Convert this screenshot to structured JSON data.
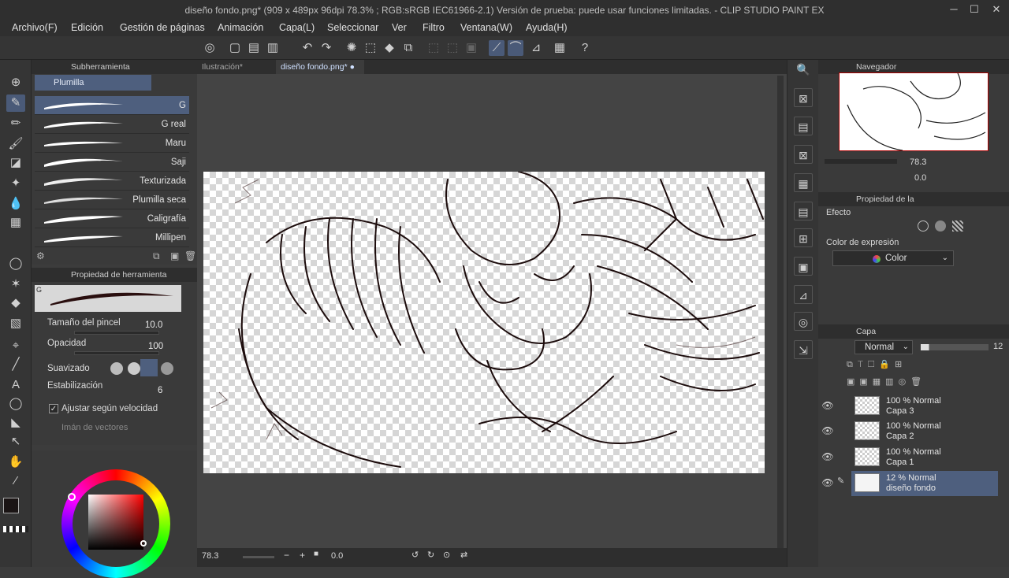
{
  "window": {
    "title": "diseño fondo.png* (909 x 489px 96dpi 78.3% ; RGB:sRGB IEC61966-2.1)  Versión de prueba: puede usar funciones limitadas. - CLIP STUDIO PAINT EX",
    "minimize": "─",
    "maximize": "☐",
    "close": "✕"
  },
  "menu": {
    "items": [
      "Archivo(F)",
      "Edición",
      "Gestión de páginas",
      "Animación",
      "Capa(L)",
      "Seleccionar",
      "Ver",
      "Filtro",
      "Ventana(W)",
      "Ayuda(H)"
    ]
  },
  "subtool": {
    "header": "Subherramienta",
    "group": "Plumilla",
    "brushes": [
      "G",
      "G real",
      "Maru",
      "Saji",
      "Texturizada",
      "Plumilla seca",
      "Caligrafía",
      "Millipen"
    ]
  },
  "tool_property": {
    "header": "Propiedad de herramienta",
    "preset_letter": "G",
    "brush_size_label": "Tamaño del pincel",
    "brush_size_value": "10.0",
    "opacity_label": "Opacidad",
    "opacity_value": "100",
    "smoothing_label": "Suavizado",
    "stabilization_label": "Estabilización",
    "stabilization_value": "6",
    "adjust_speed_label": "Ajustar según velocidad",
    "vector_magnet_label": "Imán de vectores"
  },
  "tabs": [
    {
      "label": "Ilustración*"
    },
    {
      "label": "diseño fondo.png*"
    }
  ],
  "status": {
    "zoom": "78.3",
    "angle": "0.0"
  },
  "navigator": {
    "header": "Navegador",
    "zoom": "78.3",
    "angle": "0.0"
  },
  "layer_property": {
    "header": "Propiedad de la",
    "effect_label": "Efecto",
    "expression_color_label": "Color de expresión",
    "expression_color_value": "Color"
  },
  "layers": {
    "header": "Capa",
    "blend_mode": "Normal",
    "opacity": "12",
    "items": [
      {
        "line1": "100 % Normal",
        "line2": "Capa 3",
        "selected": false
      },
      {
        "line1": "100 % Normal",
        "line2": "Capa 2",
        "selected": false
      },
      {
        "line1": "100 % Normal",
        "line2": "Capa 1",
        "selected": false
      },
      {
        "line1": "12 % Normal",
        "line2": "diseño fondo",
        "selected": true
      }
    ]
  },
  "colors": {
    "accent": "#4e5f7e",
    "main_color": "#1a1414",
    "sub_color": "#ffffff"
  }
}
